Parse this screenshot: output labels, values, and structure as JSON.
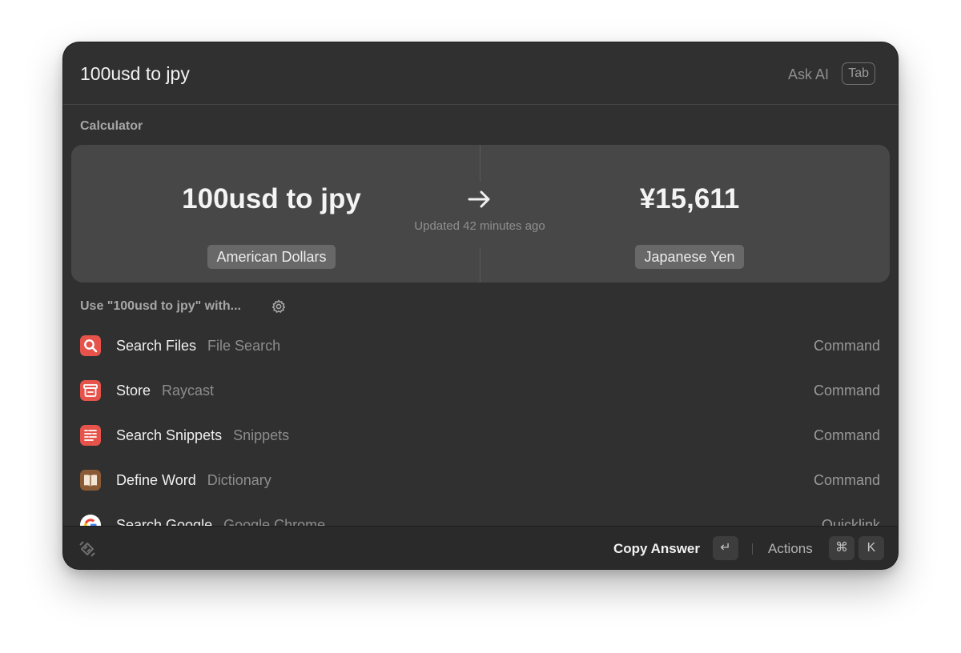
{
  "search": {
    "query": "100usd to jpy",
    "ask_ai_label": "Ask AI",
    "tab_key_label": "Tab"
  },
  "calculator": {
    "section_title": "Calculator",
    "input_expression": "100usd to jpy",
    "input_unit": "American Dollars",
    "result_value": "¥15,611",
    "result_unit": "Japanese Yen",
    "updated_text": "Updated 42 minutes ago",
    "arrow_icon": "arrow-right-icon"
  },
  "fallback": {
    "title": "Use \"100usd to jpy\" with...",
    "settings_icon": "gear-icon"
  },
  "results": [
    {
      "title": "Search Files",
      "subtitle": "File Search",
      "type": "Command",
      "icon": "magnifier-icon",
      "color": "#e5534b"
    },
    {
      "title": "Store",
      "subtitle": "Raycast",
      "type": "Command",
      "icon": "store-icon",
      "color": "#e5534b"
    },
    {
      "title": "Search Snippets",
      "subtitle": "Snippets",
      "type": "Command",
      "icon": "snippets-icon",
      "color": "#e5534b"
    },
    {
      "title": "Define Word",
      "subtitle": "Dictionary",
      "type": "Command",
      "icon": "book-icon",
      "color": "#8a5a35"
    },
    {
      "title": "Search Google",
      "subtitle": "Google Chrome",
      "type": "Quicklink",
      "icon": "google-icon",
      "color": "#ffffff"
    }
  ],
  "footer": {
    "logo_icon": "raycast-logo-icon",
    "primary_action": "Copy Answer",
    "primary_key": "↵",
    "actions_label": "Actions",
    "actions_key_modifier": "⌘",
    "actions_key": "K"
  }
}
